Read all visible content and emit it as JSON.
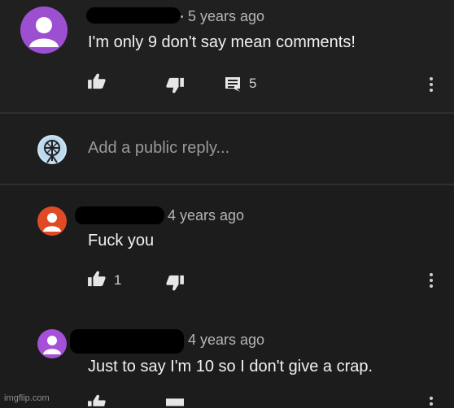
{
  "comments": [
    {
      "time": "5 years ago",
      "text": "I'm only 9 don't say mean comments!",
      "reply_count": "5",
      "avatar_color": "#9c4fd0"
    },
    {
      "time": "4 years ago",
      "text": "Fuck you",
      "like_count": "1",
      "avatar_color": "#e04a24"
    },
    {
      "time": "4 years ago",
      "text": "Just to say I'm 10 so I don't give a crap.",
      "avatar_color": "#a64fd8"
    }
  ],
  "reply_box": {
    "placeholder": "Add a public reply..."
  },
  "icons": {
    "like": "thumbs-up-icon",
    "dislike": "thumbs-down-icon",
    "replies": "comment-icon",
    "more": "kebab-menu-icon"
  },
  "watermark": "imgflip.com"
}
